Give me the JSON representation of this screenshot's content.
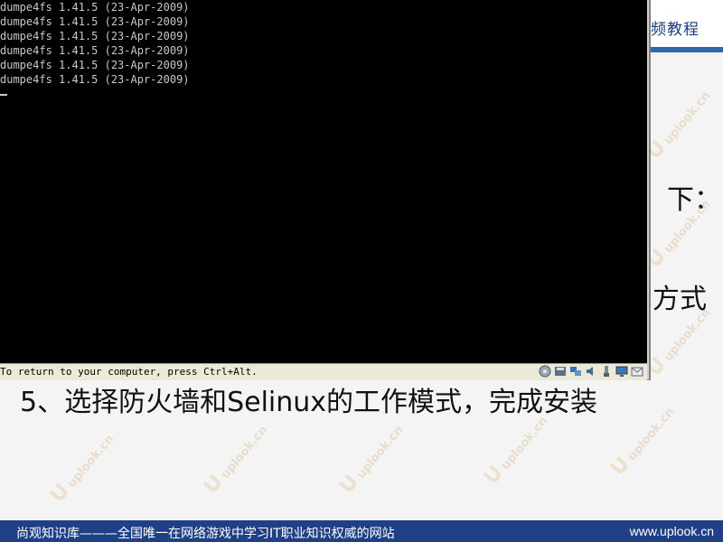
{
  "console": {
    "lines": [
      "dumpe4fs 1.41.5 (23-Apr-2009)",
      "dumpe4fs 1.41.5 (23-Apr-2009)",
      "dumpe4fs 1.41.5 (23-Apr-2009)",
      "dumpe4fs 1.41.5 (23-Apr-2009)",
      "dumpe4fs 1.41.5 (23-Apr-2009)",
      "dumpe4fs 1.41.5 (23-Apr-2009)"
    ],
    "cursor": "_"
  },
  "status_bar": {
    "message": "To return to your computer, press Ctrl+Alt.",
    "tray_icons": [
      "cd-drive-icon",
      "floppy-icon",
      "network-icon",
      "audio-icon",
      "usb-icon",
      "display-icon",
      "message-icon"
    ]
  },
  "slide": {
    "title_fragment": "频教程",
    "fragment_1": "下：",
    "fragment_2": "方式",
    "step": "5、选择防火墙和Selinux的工作模式，完成安装",
    "watermark_url": "uplook.cn",
    "watermark_text": "尚观知识库"
  },
  "footer": {
    "left": "尚观知识库———全国唯一在网络游戏中学习IT职业知识权威的网站",
    "right": "www.uplook.cn"
  },
  "colors": {
    "console_bg": "#000000",
    "console_text": "#c8c8c8",
    "footer_bg": "#1f3f86",
    "slide_accent": "#2a6aa8"
  }
}
